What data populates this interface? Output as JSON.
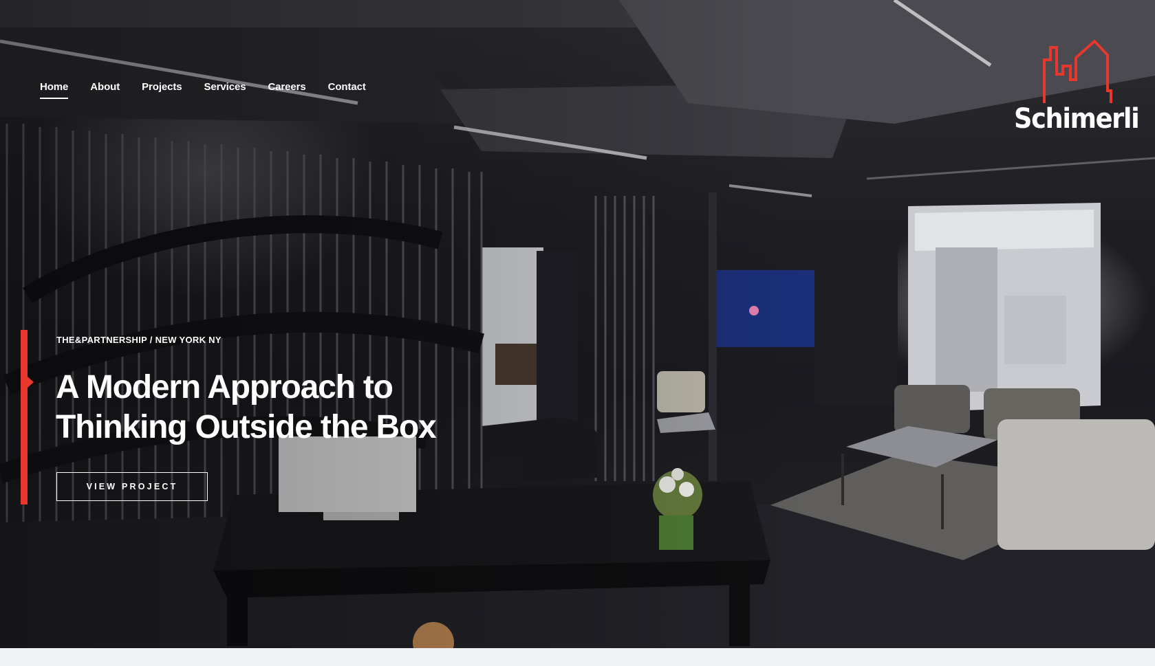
{
  "nav": {
    "items": [
      {
        "label": "Home",
        "active": true
      },
      {
        "label": "About",
        "active": false
      },
      {
        "label": "Projects",
        "active": false
      },
      {
        "label": "Services",
        "active": false
      },
      {
        "label": "Careers",
        "active": false
      },
      {
        "label": "Contact",
        "active": false
      }
    ]
  },
  "brand": {
    "name": "Schimerli",
    "logo_icon": "skyline-logo-icon",
    "accent_color": "#e8372c"
  },
  "hero": {
    "eyebrow": "THE&PARTNERSHIP / NEW YORK NY",
    "headline": "A Modern Approach to Thinking Outside the Box",
    "cta_label": "VIEW PROJECT",
    "background": "office-interior-photo"
  }
}
